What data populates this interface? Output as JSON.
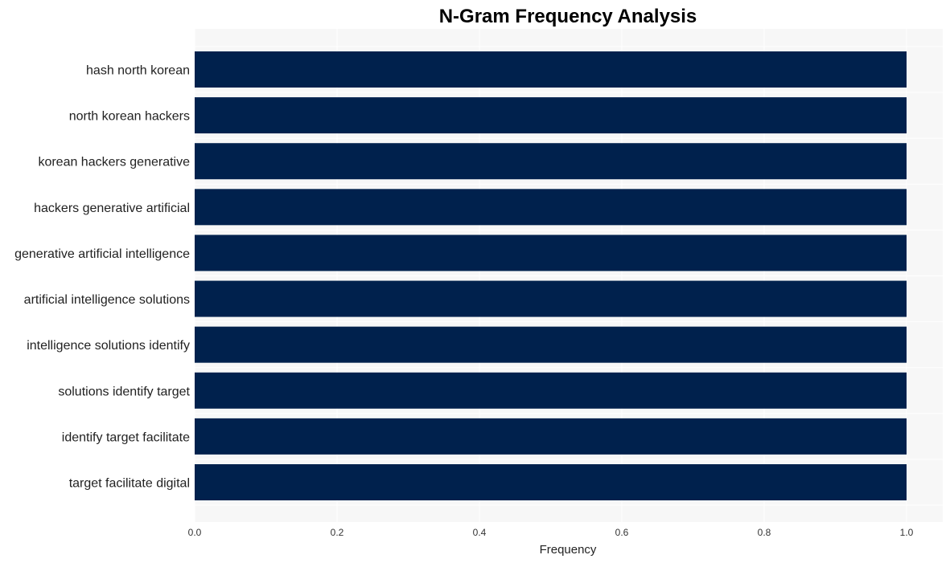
{
  "chart_data": {
    "type": "bar",
    "orientation": "horizontal",
    "title": "N-Gram Frequency Analysis",
    "xlabel": "Frequency",
    "ylabel": "",
    "categories": [
      "hash north korean",
      "north korean hackers",
      "korean hackers generative",
      "hackers generative artificial",
      "generative artificial intelligence",
      "artificial intelligence solutions",
      "intelligence solutions identify",
      "solutions identify target",
      "identify target facilitate",
      "target facilitate digital"
    ],
    "values": [
      1,
      1,
      1,
      1,
      1,
      1,
      1,
      1,
      1,
      1
    ],
    "xlim": [
      0,
      1.05
    ],
    "xticks": [
      0.0,
      0.2,
      0.4,
      0.6,
      0.8,
      1.0
    ],
    "xtick_labels": [
      "0.0",
      "0.2",
      "0.4",
      "0.6",
      "0.8",
      "1.0"
    ],
    "grid": true,
    "legend": "none",
    "colors": {
      "bar": "#00214D",
      "plot_background": "#F7F7F7",
      "grid": "#FFFFFF"
    }
  }
}
